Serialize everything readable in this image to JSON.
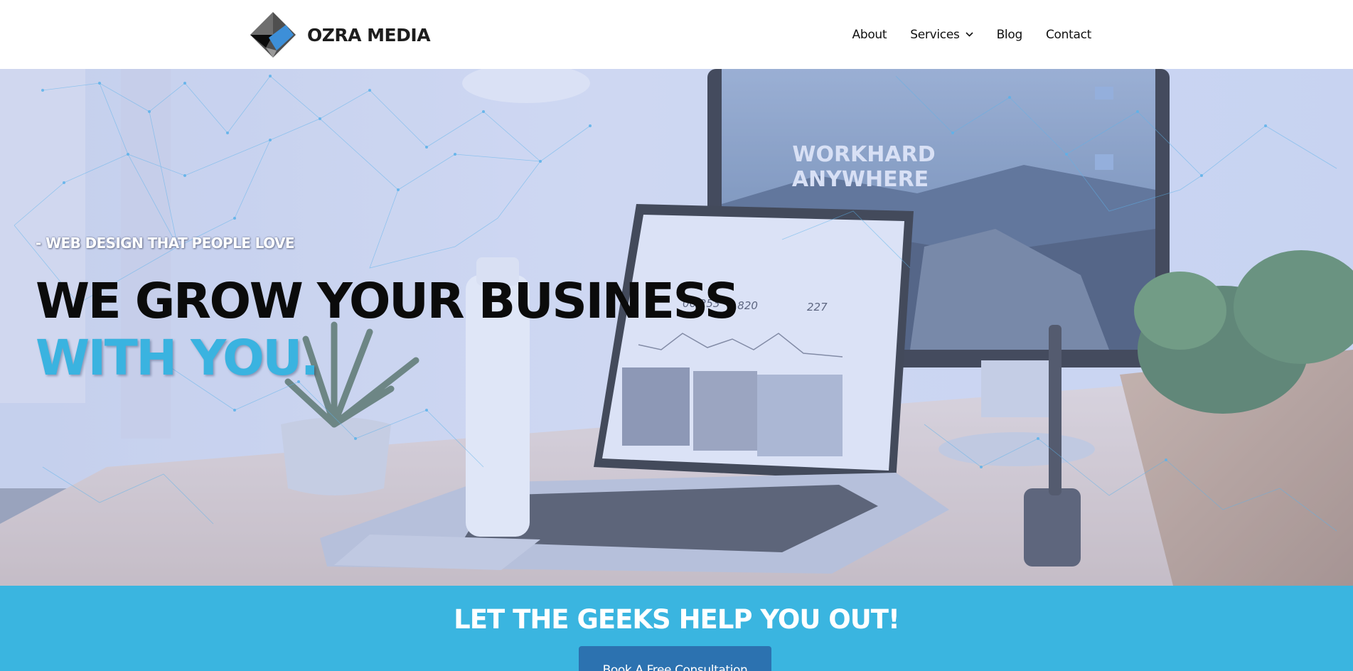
{
  "header": {
    "brand_name": "OZRA MEDIA",
    "logo_icon": "diamond-logo-icon",
    "nav": [
      {
        "label": "About"
      },
      {
        "label": "Services",
        "has_dropdown": true,
        "icon": "chevron-down-icon"
      },
      {
        "label": "Blog"
      },
      {
        "label": "Contact"
      }
    ]
  },
  "hero": {
    "tagline": "- WEB DESIGN THAT PEOPLE LOVE",
    "title_line1": "WE GROW YOUR BUSINESS",
    "title_line2": "WITH YOU.",
    "screen_text_line1": "WORKHARD",
    "screen_text_line2": "ANYWHERE",
    "laptop_stats": [
      "06,253",
      "3,820",
      "227"
    ]
  },
  "cta": {
    "heading": "LET THE GEEKS HELP YOU OUT!",
    "button_label": "Book A Free Consultation"
  },
  "colors": {
    "accent": "#3ab5e0",
    "button": "#2c72b0",
    "title_accent": "#3ab3e0",
    "text_dark": "#111111",
    "header_bg": "#ffffff"
  }
}
